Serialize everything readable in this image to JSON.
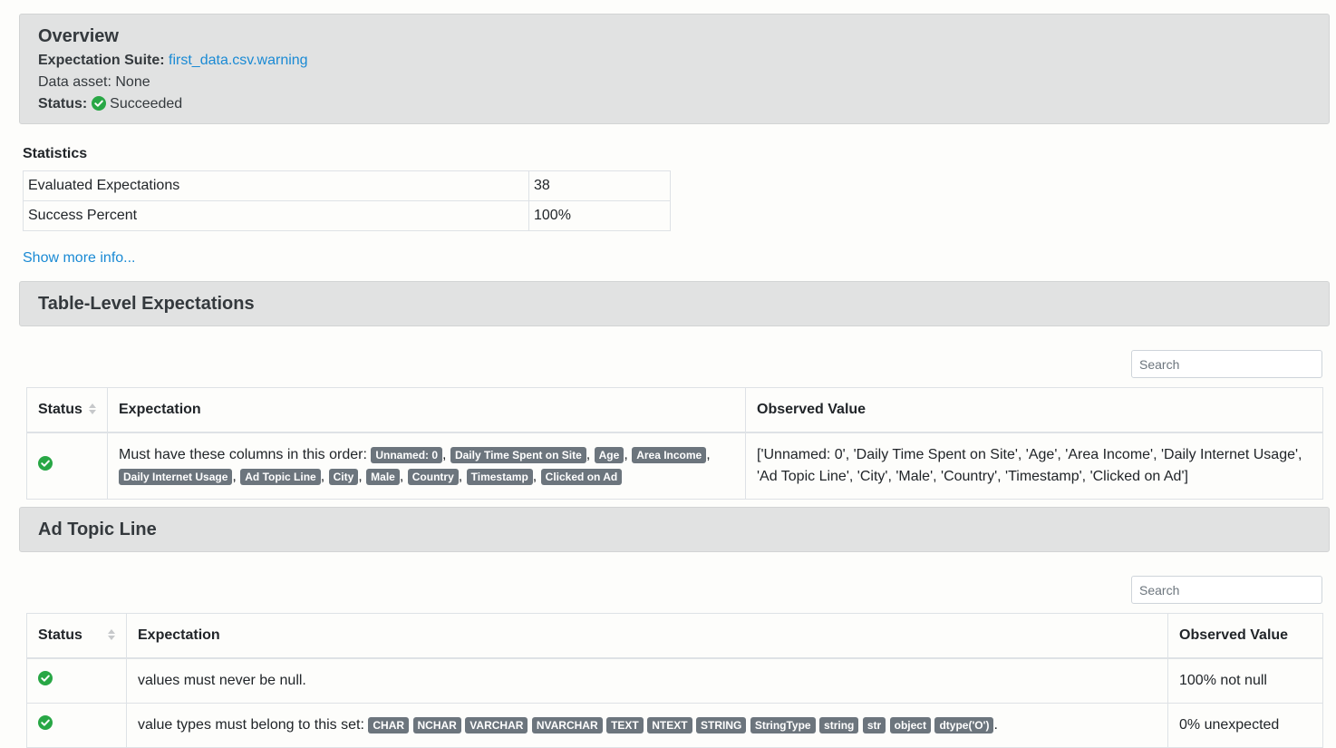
{
  "overview": {
    "title": "Overview",
    "suite_label": "Expectation Suite:",
    "suite_name": "first_data.csv.warning",
    "data_asset_text": "Data asset: None",
    "status_label": "Status:",
    "status_value": "Succeeded",
    "status_icon": "check-circle-icon"
  },
  "statistics": {
    "title": "Statistics",
    "rows": [
      {
        "label": "Evaluated Expectations",
        "value": "38"
      },
      {
        "label": "Success Percent",
        "value": "100%"
      }
    ]
  },
  "show_more": "Show more info...",
  "sections": [
    {
      "title": "Table-Level Expectations",
      "search_placeholder": "Search",
      "headers": [
        "Status",
        "Expectation",
        "Observed Value"
      ],
      "rows": [
        {
          "status_icon": "check-circle-icon",
          "expectation_text": "Must have these columns in this order:",
          "badges": [
            "Unnamed: 0",
            "Daily Time Spent on Site",
            "Age",
            "Area Income",
            "Daily Internet Usage",
            "Ad Topic Line",
            "City",
            "Male",
            "Country",
            "Timestamp",
            "Clicked on Ad"
          ],
          "observed": "['Unnamed: 0', 'Daily Time Spent on Site', 'Age', 'Area Income', 'Daily Internet Usage', 'Ad Topic Line', 'City', 'Male', 'Country', 'Timestamp', 'Clicked on Ad']"
        }
      ]
    },
    {
      "title": "Ad Topic Line",
      "search_placeholder": "Search",
      "headers": [
        "Status",
        "Expectation",
        "Observed Value"
      ],
      "rows": [
        {
          "status_icon": "check-circle-icon",
          "expectation_text": "values must never be null.",
          "badges": [],
          "observed": "100% not null"
        },
        {
          "status_icon": "check-circle-icon",
          "expectation_text": "value types must belong to this set:",
          "badges": [
            "CHAR",
            "NCHAR",
            "VARCHAR",
            "NVARCHAR",
            "TEXT",
            "NTEXT",
            "STRING",
            "StringType",
            "string",
            "str",
            "object",
            "dtype('O')"
          ],
          "observed": "0% unexpected"
        }
      ]
    }
  ],
  "colors": {
    "success": "#28a745",
    "link": "#1a8ad4",
    "badge": "#6c757d",
    "header_bg": "#e1e2e2"
  }
}
